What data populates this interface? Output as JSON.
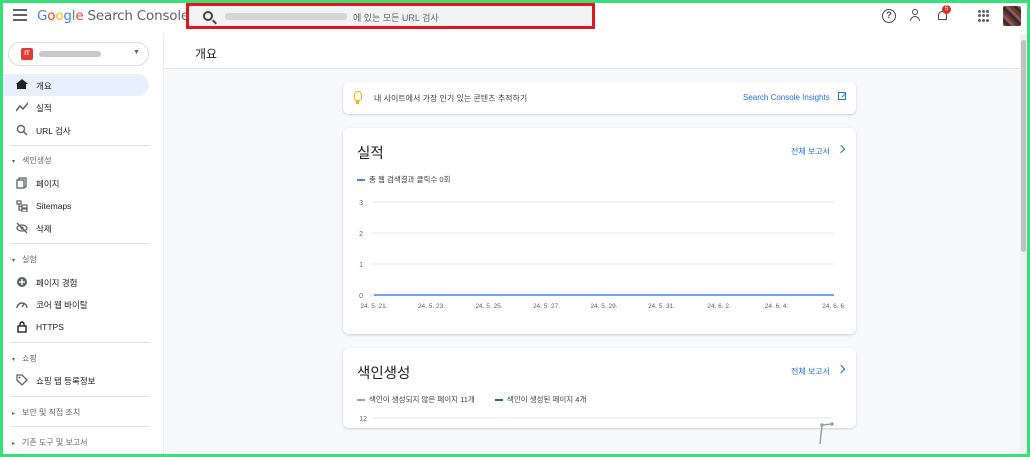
{
  "header": {
    "logo": {
      "g1": "G",
      "g2": "o",
      "g3": "o",
      "g4": "g",
      "g5": "l",
      "g6": "e",
      "product": "Search Console"
    },
    "search": {
      "placeholder": "에 있는 모든 URL 검사"
    },
    "notification_count": "5",
    "icons": [
      "menu-icon",
      "search-icon",
      "help-icon",
      "user-settings-icon",
      "bell-icon",
      "apps-icon"
    ]
  },
  "sidebar": {
    "property_badge": "IT",
    "items": [
      {
        "label": "개요",
        "icon": "home-icon",
        "active": true
      },
      {
        "label": "실적",
        "icon": "trending-icon"
      },
      {
        "label": "URL 검사",
        "icon": "search-icon"
      }
    ],
    "sections": [
      {
        "title": "색인생성",
        "items": [
          {
            "label": "페이지",
            "icon": "pages-icon"
          },
          {
            "label": "Sitemaps",
            "icon": "sitemap-icon"
          },
          {
            "label": "삭제",
            "icon": "remove-icon"
          }
        ]
      },
      {
        "title": "실험",
        "items": [
          {
            "label": "페이지 경험",
            "icon": "experience-icon"
          },
          {
            "label": "코어 웹 바이탈",
            "icon": "speed-icon"
          },
          {
            "label": "HTTPS",
            "icon": "lock-icon"
          }
        ]
      },
      {
        "title": "쇼핑",
        "items": [
          {
            "label": "쇼핑 탭 등록정보",
            "icon": "tag-icon"
          }
        ]
      },
      {
        "title": "보안 및 직접 조치"
      },
      {
        "title": "기존 도구 및 보고서"
      }
    ]
  },
  "main": {
    "page_title": "개요",
    "tip": {
      "text": "내 사이트에서 가장 인기 있는 콘텐츠 추적하기",
      "link": "Search Console Insights"
    },
    "performance": {
      "title": "실적",
      "link": "전체 보고서",
      "legend": "총 웹 검색결과 클릭수 0회",
      "series_color": "#4285f4"
    },
    "indexing": {
      "title": "색인생성",
      "link": "전체 보고서",
      "legend_not_indexed": "색인이 생성되지 않은 페이지 11개",
      "legend_indexed": "색인이 생성된 페이지 4개",
      "not_indexed_color": "#9aa0a6",
      "indexed_color": "#188038",
      "y_top_label": "12"
    }
  },
  "chart_data": [
    {
      "type": "line",
      "title": "실적",
      "x": [
        "24. 5. 21.",
        "24. 5. 23.",
        "24. 5. 25.",
        "24. 5. 27.",
        "24. 5. 29.",
        "24. 5. 31.",
        "24. 6. 2.",
        "24. 6. 4.",
        "24. 6. 6."
      ],
      "y_ticks": [
        "3",
        "2",
        "1",
        "0"
      ],
      "ylim": [
        0,
        3
      ],
      "series": [
        {
          "name": "총 웹 검색결과 클릭수 0회",
          "values": [
            0,
            0,
            0,
            0,
            0,
            0,
            0,
            0,
            0
          ]
        }
      ],
      "grid": true
    },
    {
      "type": "line",
      "title": "색인생성",
      "y_ticks": [
        "12"
      ],
      "series": [
        {
          "name": "색인이 생성되지 않은 페이지 11개",
          "values": [
            11,
            11
          ]
        }
      ]
    }
  ]
}
